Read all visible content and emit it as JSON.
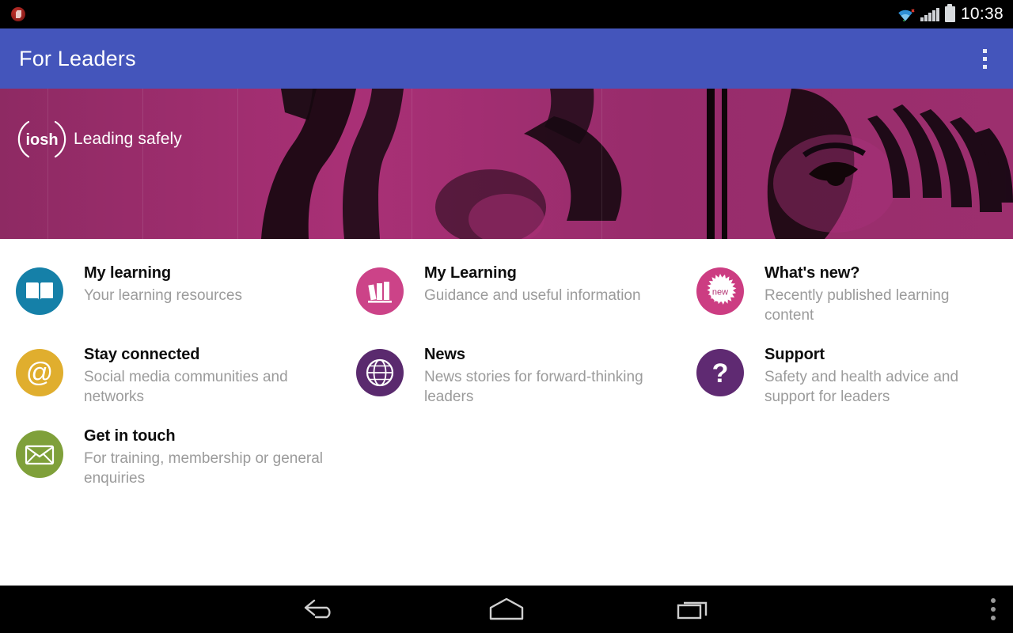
{
  "status_bar": {
    "app_notification_icon": "app-notification-icon",
    "wifi_icon": "wifi-icon",
    "signal_icon": "signal-bars-icon",
    "battery_icon": "battery-icon",
    "time": "10:38"
  },
  "action_bar": {
    "title": "For Leaders",
    "overflow_icon": "overflow-menu-icon",
    "background_color": "#4455bb"
  },
  "hero": {
    "logo_text": "Leading safely",
    "logo_mark": "iosh",
    "background_color": "#9c2f6e"
  },
  "menu": {
    "rows": [
      [
        {
          "title": "My learning",
          "subtitle": "Your learning resources",
          "icon": "open-book-icon",
          "color": "#1580a8"
        },
        {
          "title": "My Learning",
          "subtitle": "Guidance and useful information",
          "icon": "bookshelf-icon",
          "color": "#cc4388"
        },
        {
          "title": "What's new?",
          "subtitle": "Recently published learning content",
          "icon": "new-starburst-icon",
          "color": "#cc3d82",
          "badge_text": "new"
        }
      ],
      [
        {
          "title": "Stay connected",
          "subtitle": "Social media communities and networks",
          "icon": "at-sign-icon",
          "color": "#e0ae2e"
        },
        {
          "title": "News",
          "subtitle": "News stories for forward-thinking leaders",
          "icon": "globe-icon",
          "color": "#5a2a6e"
        },
        {
          "title": "Support",
          "subtitle": "Safety and health advice and support for leaders",
          "icon": "question-mark-icon",
          "color": "#5f2a72"
        }
      ],
      [
        {
          "title": "Get in touch",
          "subtitle": "For training, membership or general enquiries",
          "icon": "envelope-icon",
          "color": "#7fa03a"
        }
      ]
    ]
  },
  "nav_bar": {
    "back_icon": "back-arrow-icon",
    "home_icon": "home-icon",
    "recents_icon": "recent-apps-icon",
    "more_icon": "nav-more-icon"
  }
}
